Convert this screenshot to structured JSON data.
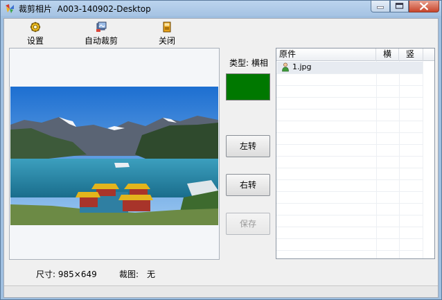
{
  "window": {
    "title": "裁剪相片",
    "computer": "A003-140902-Desktop"
  },
  "toolbar": {
    "settings_label": "设置",
    "auto_crop_label": "自动裁剪",
    "close_label": "关闭"
  },
  "crop": {
    "type_label": "类型: 横相",
    "swatch_color": "#007800",
    "rotate_left_label": "左转",
    "rotate_right_label": "右转",
    "save_label": "保存"
  },
  "file_list": {
    "columns": [
      "原件",
      "横",
      "竖"
    ],
    "rows": [
      {
        "name": "1.jpg",
        "landscape": "",
        "portrait": ""
      }
    ]
  },
  "status": {
    "size_text": "尺寸: 985×649",
    "crop_label": "裁图:",
    "crop_value": "无"
  }
}
